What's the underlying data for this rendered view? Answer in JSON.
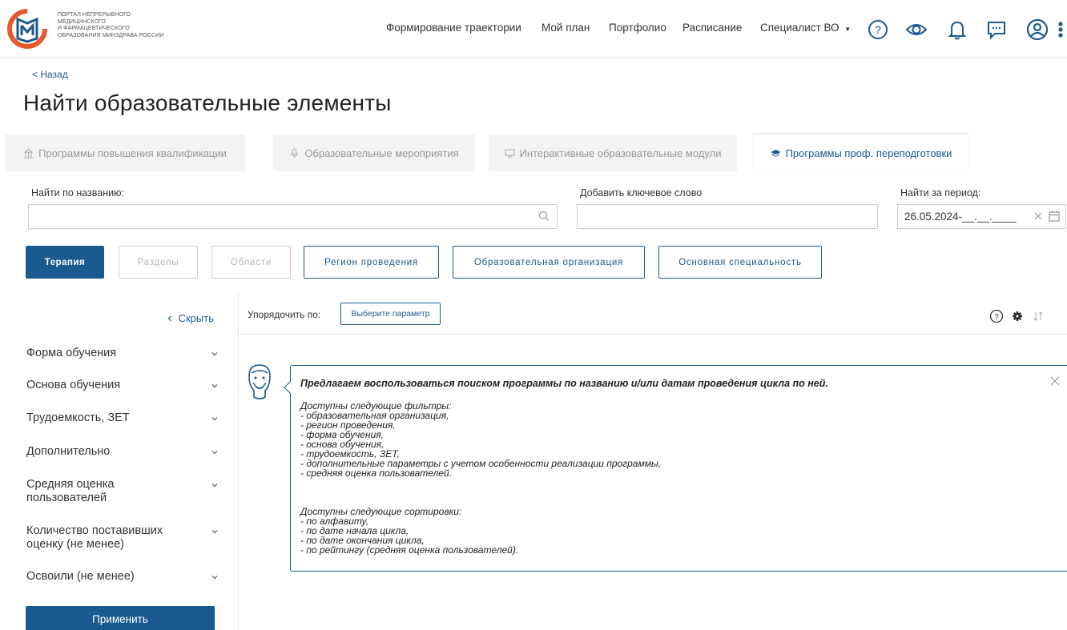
{
  "header": {
    "logo_text": [
      "ПОРТАЛ НЕПРЕРЫВНОГО",
      "МЕДИЦИНСКОГО",
      "И ФАРМАЦЕВТИЧЕСКОГО",
      "ОБРАЗОВАНИЯ МИНЗДРАВА РОССИИ"
    ],
    "nav": {
      "trajectory": "Формирование траектории",
      "plan": "Мой план",
      "portfolio": "Портфолио",
      "schedule": "Расписание",
      "role": "Специалист ВО"
    }
  },
  "back_label": "< Назад",
  "page_title": "Найти образовательные элементы",
  "tabs": [
    {
      "label": "Программы повышения квалификации",
      "icon": "building-icon"
    },
    {
      "label": "Образовательные мероприятия",
      "icon": "microphone-icon"
    },
    {
      "label": "Интерактивные образовательные модули",
      "icon": "monitor-icon"
    },
    {
      "label": "Программы проф. переподготовки",
      "icon": "graduation-cap-icon"
    }
  ],
  "search": {
    "name_label": "Найти по названию:",
    "name_value": "",
    "keyword_label": "Добавить ключевое слово",
    "keyword_value": "",
    "period_label": "Найти за период:",
    "period_value": "26.05.2024-__.__.____"
  },
  "filters": {
    "therapy": "Терапия",
    "sections": "Разделы",
    "areas": "Области",
    "region": "Регион проведения",
    "organization": "Образовательная организация",
    "specialty": "Основная специальность"
  },
  "sidebar": {
    "hide_label": "Скрыть",
    "facets": [
      "Форма обучения",
      "Основа обучения",
      "Трудоемкость, ЗЕТ",
      "Дополнительно",
      "Средняя оценка пользователей",
      "Количество поставивших оценку (не менее)",
      "Освоили (не менее)"
    ],
    "apply_label": "Применить"
  },
  "sort": {
    "label": "Упорядочить по:",
    "button": "Выберите параметр"
  },
  "info": {
    "title": "Предлагаем воспользоваться поиском программы по названию и/или датам проведения цикла по ней.",
    "filters_heading": "Доступны следующие фильтры:",
    "filters": [
      "- образовательная организация,",
      "- регион проведения,",
      "- форма обучения,",
      "- основа обучения,",
      "- трудоемкость, ЗЕТ,",
      "- дополнительные параметры с учетом особенности реализации программы,",
      "- средняя оценка пользователей."
    ],
    "sorts_heading": "Доступны следующие сортировки:",
    "sorts": [
      "- по алфавиту,",
      "- по дате начала цикла,",
      "- по дате окончания цикла,",
      "- по рейтингу (средняя оценка пользователей)."
    ]
  },
  "colors": {
    "primary": "#1b5a8e",
    "logo_orange": "#e8582b"
  }
}
